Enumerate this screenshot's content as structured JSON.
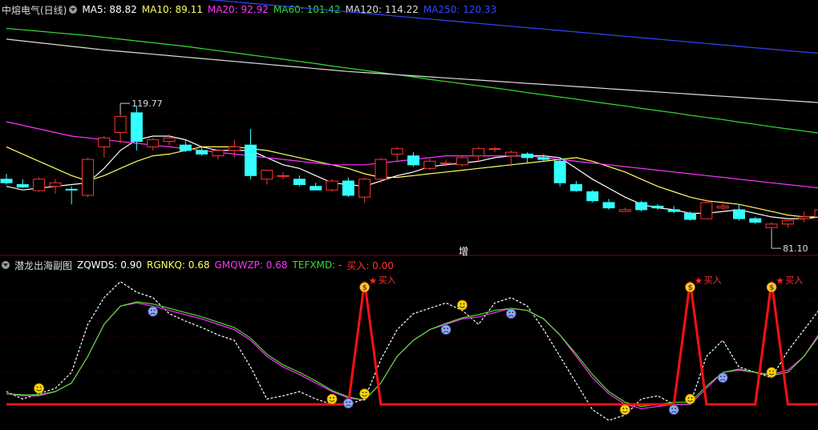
{
  "main_panel": {
    "title": "中熔电气(日线)",
    "ma_labels": [
      {
        "text": "MA5: 88.82",
        "color": "#ffffff"
      },
      {
        "text": "MA10: 89.11",
        "color": "#ffff66"
      },
      {
        "text": "MA20: 92.92",
        "color": "#ff33ff"
      },
      {
        "text": "MA60: 101.42",
        "color": "#33dd33"
      },
      {
        "text": "MA120: 114.22",
        "color": "#dddddd"
      },
      {
        "text": "MA250: 120.33",
        "color": "#3344ff"
      }
    ],
    "high_label": "119.77",
    "low_label": "81.10",
    "center_marker": "增"
  },
  "sub_panel": {
    "title": "潜龙出海副图",
    "indicators": [
      {
        "text": "ZQWDS: 0.90",
        "color": "#ffffff"
      },
      {
        "text": "RGNKQ: 0.68",
        "color": "#ffff66"
      },
      {
        "text": "GMQWZP: 0.68",
        "color": "#ff33ff"
      },
      {
        "text": "TEFXMD: -",
        "color": "#33dd33"
      },
      {
        "text": "买入: 0.00",
        "color": "#ff3333"
      }
    ],
    "buy_labels": [
      "买入",
      "买入",
      "买入"
    ]
  },
  "colors": {
    "up": "#ff3333",
    "down": "#33ffff",
    "ma5": "#ffffff",
    "ma10": "#ffff66",
    "ma20": "#ff33ff",
    "ma60": "#33dd33",
    "ma120": "#dddddd",
    "ma250": "#3344ff",
    "buy": "#ff1111",
    "grid": "#5a0000"
  },
  "chart_data": {
    "type": "candlestick",
    "title": "中熔电气(日线)",
    "ohlc_approx": [
      [
        95.0,
        96.5,
        93.5,
        94.0
      ],
      [
        93.5,
        95.0,
        92.5,
        92.8
      ],
      [
        91.8,
        95.5,
        91.5,
        95.0
      ],
      [
        93.0,
        95.0,
        91.0,
        94.0
      ],
      [
        92.2,
        93.0,
        88.0,
        92.0
      ],
      [
        90.5,
        101.0,
        90.0,
        100.5
      ],
      [
        104.0,
        107.0,
        101.0,
        106.5
      ],
      [
        108.0,
        113.0,
        105.0,
        112.5
      ],
      [
        113.5,
        115.5,
        103.0,
        105.5
      ],
      [
        104.0,
        106.5,
        103.0,
        106.0
      ],
      [
        105.5,
        107.5,
        104.5,
        106.5
      ],
      [
        104.5,
        106.0,
        102.5,
        103.0
      ],
      [
        103.0,
        104.0,
        101.5,
        102.0
      ],
      [
        101.5,
        103.5,
        100.5,
        103.0
      ],
      [
        103.0,
        106.0,
        101.0,
        104.0
      ],
      [
        104.5,
        109.0,
        95.0,
        96.0
      ],
      [
        95.0,
        97.5,
        93.5,
        97.5
      ],
      [
        96.0,
        97.0,
        95.0,
        96.0
      ],
      [
        95.0,
        96.0,
        93.0,
        93.5
      ],
      [
        93.0,
        94.0,
        92.0,
        92.0
      ],
      [
        92.0,
        95.0,
        91.5,
        94.5
      ],
      [
        94.5,
        95.5,
        90.0,
        90.5
      ],
      [
        90.0,
        95.5,
        88.5,
        95.0
      ],
      [
        95.0,
        101.0,
        94.0,
        100.5
      ],
      [
        102.0,
        104.0,
        100.0,
        103.5
      ],
      [
        101.5,
        102.5,
        98.5,
        99.0
      ],
      [
        98.0,
        101.0,
        97.5,
        100.0
      ],
      [
        99.5,
        100.5,
        98.5,
        99.5
      ],
      [
        99.0,
        101.5,
        98.5,
        101.0
      ],
      [
        101.5,
        104.0,
        100.0,
        103.5
      ],
      [
        103.5,
        104.0,
        102.5,
        103.5
      ],
      [
        101.5,
        103.0,
        98.5,
        102.5
      ],
      [
        102.0,
        102.5,
        99.5,
        101.0
      ],
      [
        101.0,
        102.0,
        100.0,
        100.5
      ],
      [
        100.0,
        101.0,
        93.0,
        94.0
      ],
      [
        93.5,
        94.5,
        91.5,
        91.8
      ],
      [
        91.5,
        92.0,
        88.5,
        89.0
      ],
      [
        88.5,
        89.5,
        86.5,
        87.0
      ],
      [
        86.0,
        87.0,
        86.0,
        86.5
      ],
      [
        88.5,
        89.0,
        86.0,
        86.5
      ],
      [
        87.5,
        88.0,
        86.5,
        87.0
      ],
      [
        86.5,
        87.5,
        85.5,
        86.0
      ],
      [
        85.5,
        86.0,
        83.5,
        83.8
      ],
      [
        84.0,
        89.5,
        84.0,
        88.5
      ],
      [
        87.0,
        89.0,
        86.5,
        87.5
      ],
      [
        86.5,
        88.0,
        83.5,
        84.0
      ],
      [
        84.0,
        84.5,
        82.5,
        83.0
      ],
      [
        81.5,
        83.0,
        81.1,
        82.5
      ],
      [
        82.5,
        83.5,
        81.5,
        83.5
      ],
      [
        84.0,
        86.0,
        83.0,
        84.5
      ],
      [
        84.5,
        88.5,
        84.0,
        86.5
      ]
    ],
    "series": [
      {
        "name": "MA5",
        "values": [
          93,
          92,
          92.5,
          93,
          93.5,
          94,
          98,
          103,
          106,
          107,
          107,
          106,
          104,
          103,
          103,
          103,
          101,
          99,
          98,
          96,
          94,
          93.5,
          93,
          94.5,
          96,
          97,
          98.5,
          99,
          99.5,
          100,
          101,
          101.5,
          101.5,
          101.5,
          101,
          98,
          95,
          92.5,
          90,
          88,
          87,
          86.5,
          85.5,
          85.5,
          86,
          86.5,
          85.5,
          84.5,
          84,
          84,
          84.5
        ]
      },
      {
        "name": "MA10",
        "values": [
          104,
          102,
          100,
          98,
          96,
          94.5,
          96,
          98,
          100,
          101.5,
          102,
          103,
          104,
          104,
          104,
          103.5,
          103,
          102,
          101,
          100,
          99,
          98,
          96.5,
          95.5,
          95.5,
          96,
          96.5,
          97,
          97.5,
          98,
          98.5,
          99,
          99.5,
          100,
          100.5,
          101,
          100,
          98.5,
          97,
          95,
          93,
          91.5,
          90,
          89,
          88.5,
          88,
          87,
          86,
          85,
          84.5,
          84.5
        ]
      },
      {
        "name": "MA20",
        "values": [
          111,
          110,
          109,
          108,
          107,
          106.5,
          106,
          105.5,
          105,
          104.5,
          104,
          103.5,
          103,
          102.5,
          102,
          101.5,
          101,
          100.5,
          100,
          99.5,
          99,
          99,
          99,
          99.5,
          100,
          100.5,
          101,
          101.5,
          101.5,
          101.5,
          101.5,
          101.5,
          101.5,
          101,
          100.5,
          100,
          99.5,
          99,
          98.5,
          98,
          97.5,
          97,
          96.5,
          96,
          95.5,
          95,
          94.5,
          94,
          93.5,
          93,
          92.5
        ]
      },
      {
        "name": "MA60",
        "values": [
          137,
          136.6,
          136.2,
          135.8,
          135.4,
          135,
          134.5,
          134,
          133.5,
          133,
          132.5,
          132,
          131.4,
          130.8,
          130.2,
          129.6,
          129,
          128.4,
          127.8,
          127.2,
          126.5,
          125.9,
          125.3,
          124.7,
          124.1,
          123.5,
          122.8,
          122.2,
          121.6,
          121,
          120.4,
          119.8,
          119.1,
          118.5,
          117.9,
          117.3,
          116.6,
          116,
          115.4,
          114.7,
          114.1,
          113.5,
          112.8,
          112.2,
          111.6,
          110.9,
          110.3,
          109.6,
          109,
          108.4,
          107.8
        ]
      },
      {
        "name": "MA120",
        "values": [
          134,
          133.5,
          133,
          132.5,
          132,
          131.5,
          131,
          130.6,
          130.2,
          129.8,
          129.4,
          129,
          128.6,
          128.2,
          127.8,
          127.4,
          127,
          126.6,
          126.2,
          125.8,
          125.4,
          125,
          124.7,
          124.4,
          124.1,
          123.8,
          123.5,
          123.2,
          122.9,
          122.6,
          122.3,
          122,
          121.7,
          121.4,
          121.1,
          120.8,
          120.5,
          120.2,
          119.9,
          119.6,
          119.3,
          119,
          118.7,
          118.4,
          118.1,
          117.8,
          117.5,
          117.2,
          116.9,
          116.6,
          116.3
        ]
      },
      {
        "name": "MA250",
        "values": [
          150,
          149.6,
          149.2,
          148.8,
          148.4,
          148,
          147.6,
          147.2,
          146.8,
          146.4,
          146,
          145.6,
          145.2,
          144.8,
          144.4,
          144,
          143.6,
          143.2,
          142.8,
          142.4,
          142,
          141.6,
          141.2,
          140.8,
          140.4,
          140,
          139.6,
          139.2,
          138.8,
          138.4,
          138,
          137.6,
          137.2,
          136.8,
          136.4,
          136,
          135.6,
          135.2,
          134.8,
          134.4,
          134,
          133.6,
          133.2,
          132.8,
          132.4,
          132,
          131.6,
          131.2,
          130.8,
          130.4,
          130
        ]
      }
    ],
    "annotations": [
      "119.77",
      "81.10"
    ]
  },
  "sub_chart_data": {
    "type": "line",
    "x_count": 51,
    "series": [
      {
        "name": "ZQWDS",
        "values": [
          0.12,
          0.05,
          0.1,
          0.15,
          0.3,
          0.75,
          1.0,
          1.15,
          1.05,
          1.0,
          0.85,
          0.78,
          0.72,
          0.65,
          0.6,
          0.35,
          0.05,
          0.08,
          0.12,
          0.05,
          0.0,
          0.0,
          0.05,
          0.42,
          0.7,
          0.85,
          0.9,
          0.95,
          0.88,
          0.75,
          0.95,
          1.0,
          0.92,
          0.7,
          0.45,
          0.2,
          -0.05,
          -0.15,
          -0.1,
          0.05,
          0.08,
          0.0,
          0.0,
          0.45,
          0.6,
          0.35,
          0.3,
          0.25,
          0.5,
          0.7,
          0.9
        ]
      },
      {
        "name": "GMQWZP",
        "values": [
          0.1,
          0.08,
          0.08,
          0.12,
          0.2,
          0.45,
          0.75,
          0.92,
          0.95,
          0.92,
          0.88,
          0.84,
          0.8,
          0.75,
          0.7,
          0.6,
          0.45,
          0.35,
          0.28,
          0.2,
          0.12,
          0.06,
          0.04,
          0.2,
          0.45,
          0.6,
          0.7,
          0.75,
          0.8,
          0.82,
          0.86,
          0.9,
          0.88,
          0.8,
          0.65,
          0.45,
          0.25,
          0.1,
          0.0,
          -0.04,
          -0.02,
          0.0,
          0.0,
          0.15,
          0.3,
          0.32,
          0.3,
          0.28,
          0.32,
          0.45,
          0.68
        ]
      },
      {
        "name": "TEFXMD",
        "values": [
          0.1,
          0.09,
          0.09,
          0.12,
          0.2,
          0.45,
          0.75,
          0.92,
          0.96,
          0.94,
          0.9,
          0.86,
          0.82,
          0.77,
          0.72,
          0.62,
          0.47,
          0.37,
          0.3,
          0.22,
          0.13,
          0.07,
          0.04,
          0.2,
          0.45,
          0.6,
          0.7,
          0.76,
          0.81,
          0.84,
          0.88,
          0.9,
          0.88,
          0.8,
          0.65,
          0.47,
          0.28,
          0.12,
          0.02,
          -0.02,
          0.0,
          0.02,
          0.02,
          0.17,
          0.3,
          0.33,
          0.3,
          0.27,
          0.3,
          0.45,
          0.66
        ]
      },
      {
        "name": "买入",
        "values": [
          0,
          0,
          0,
          0,
          0,
          0,
          0,
          0,
          0,
          0,
          0,
          0,
          0,
          0,
          0,
          0,
          0,
          0,
          0,
          0,
          0,
          0,
          1.15,
          0,
          0,
          0,
          0,
          0,
          0,
          0,
          0,
          0,
          0,
          0,
          0,
          0,
          0,
          0,
          0,
          0,
          0,
          0,
          1.15,
          0,
          0,
          0,
          0,
          1.15,
          0,
          0,
          0
        ]
      }
    ],
    "happy_marks": [
      2,
      20,
      22,
      28,
      38,
      42,
      47
    ],
    "sad_marks": [
      9,
      21,
      27,
      31,
      41,
      44
    ],
    "buy_marks": [
      22,
      42,
      47
    ]
  }
}
